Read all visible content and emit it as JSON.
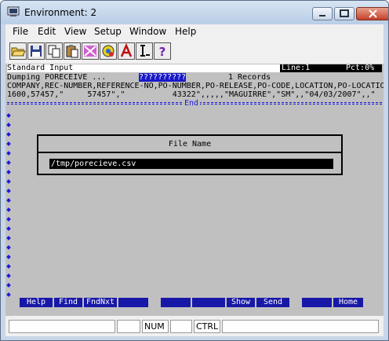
{
  "window": {
    "title": "Environment: 2"
  },
  "menu": {
    "items": [
      "File",
      "Edit",
      "View",
      "Setup",
      "Window",
      "Help"
    ]
  },
  "toolbar": {
    "tools": [
      "open-folder-icon",
      "save-disk-icon",
      "copy-icon",
      "paste-icon",
      "color-palette-icon",
      "settings-gear-icon",
      "font-a-icon",
      "text-cursor-icon",
      "help-question-icon"
    ]
  },
  "terminal": {
    "header_left": "Standard Input",
    "header_line": "Line:1",
    "header_pct": "Pct:0%",
    "dump_label": "Dumping PORECEIVE ...",
    "dump_highlight": "??????????",
    "dump_records": "1 Records",
    "columns_line": "COMPANY,REC-NUMBER,REFERENCE-NO,PO-NUMBER,PO-RELEASE,PO-CODE,LOCATION,PO-LOCATIO",
    "data_line": "1600,57457,\"     57457\",\"          43322\",,,,,\"MAGUIRRE\",\"SM\",,\"04/03/2007\",,\"",
    "end_label": "End",
    "dialog_title": "File Name",
    "file_path": "/tmp/porecieve.csv",
    "fkeys": [
      "Help",
      "Find",
      "FndNxt",
      "",
      "",
      "",
      "Show",
      "Send",
      "",
      "Home"
    ]
  },
  "status": {
    "num": "NUM",
    "ctrl": "CTRL"
  },
  "colors": {
    "accent": "#1818a8",
    "terminal_bg": "#c0c0c0",
    "dots": "#1a1ad8"
  }
}
